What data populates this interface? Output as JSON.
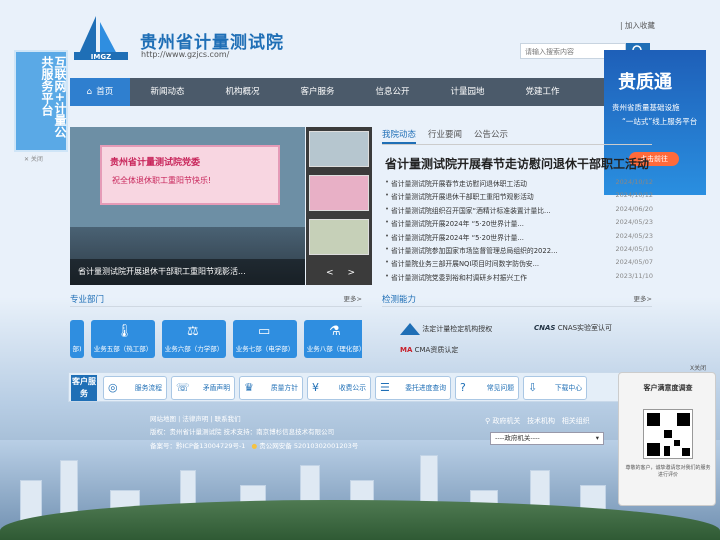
{
  "header": {
    "logo_abbr": "IMGZ",
    "title": "贵州省计量测试院",
    "url": "http://www.gzjcs.com/",
    "favorite": "| 加入收藏",
    "search_placeholder": "请输入搜索内容"
  },
  "nav": {
    "items": [
      {
        "label": "首页",
        "icon": "home-icon"
      },
      {
        "label": "新闻动态"
      },
      {
        "label": "机构概况"
      },
      {
        "label": "客户服务"
      },
      {
        "label": "信息公开"
      },
      {
        "label": "计量园地"
      },
      {
        "label": "党建工作"
      }
    ]
  },
  "float_left": {
    "text": "互联网+计量公共服务平台"
  },
  "ad_right": {
    "title": "贵质通",
    "subtitle1": "贵州省质量基础设施",
    "subtitle2": "“一站式”线上服务平台",
    "button": "点击前往"
  },
  "slide": {
    "banner_title": "贵州省计量测试院党委",
    "banner_sub": "祝全体退休职工重阳节快乐!",
    "caption": "省计量测试院开展退休干部职工重阳节观影活...",
    "prev": "<",
    "next": ">"
  },
  "news": {
    "tabs": [
      "我院动态",
      "行业要闻",
      "公告公示"
    ],
    "headline": "省计量测试院开展春节走访慰问退休干部职工活动",
    "items": [
      {
        "title": "省计量测试院开展春节走访慰问退休职工活动",
        "date": "2024/10/12"
      },
      {
        "title": "省计量测试院开展退休干部职工重阳节观影活动",
        "date": "2024/10/12"
      },
      {
        "title": "省计量测试院组织召开国家“酒精计标准装置计量比...",
        "date": "2024/06/20"
      },
      {
        "title": "省计量测试院开展2024年 “5·20世界计量...",
        "date": "2024/05/23"
      },
      {
        "title": "省计量测试院开展2024年 “5·20世界计量...",
        "date": "2024/05/23"
      },
      {
        "title": "省计量测试院参加国家市场监督管理总局组织的2022...",
        "date": "2024/05/10"
      },
      {
        "title": "省计量院业务三部开展NQI项目时间数字防伪安...",
        "date": "2024/05/07"
      },
      {
        "title": "省计量测试院党委到裕和村调研乡村振兴工作",
        "date": "2023/11/10"
      }
    ]
  },
  "departments": {
    "title": "专业部门",
    "more": "更多>",
    "items": [
      {
        "label": "部)",
        "icon": "flask-icon"
      },
      {
        "label": "业务五部（热工部）",
        "icon": "thermometer-icon"
      },
      {
        "label": "业务六部（力学部）",
        "icon": "scale-icon"
      },
      {
        "label": "业务七部（电学部）",
        "icon": "battery-icon"
      },
      {
        "label": "业务八部（理化部）",
        "icon": "flask-icon"
      }
    ]
  },
  "abilities": {
    "title": "检测能力",
    "more": "更多>",
    "items": [
      {
        "label": "法定计量检定机构授权",
        "icon": "triangle-logo-icon"
      },
      {
        "label": "CNAS实验室认可",
        "icon": "cnas-logo-icon"
      },
      {
        "label": "CMA资质认定",
        "icon": "cma-logo-icon"
      }
    ]
  },
  "service": {
    "label": "客户服务",
    "items": [
      {
        "label": "服务流程",
        "icon": "flow-icon"
      },
      {
        "label": "矛盾声明",
        "icon": "statement-icon"
      },
      {
        "label": "质量方针",
        "icon": "quality-icon"
      },
      {
        "label": "收费公示",
        "icon": "fee-icon"
      },
      {
        "label": "委托进度查询",
        "icon": "progress-icon"
      },
      {
        "label": "常见问题",
        "icon": "faq-icon"
      },
      {
        "label": "下载中心",
        "icon": "download-icon"
      }
    ]
  },
  "footer": {
    "links": "网站地图 | 法律声明 | 联系我们",
    "copyright": "版权：贵州省计量测试院   技术支持：南京博杉信息技术有限公司",
    "icp": "备案号：黔ICP备13004729号-1",
    "police": "贵公网安备 52010302001203号",
    "right_links": [
      "政府机关",
      "技术机构",
      "相关组织"
    ],
    "select": "----政府机关----"
  },
  "survey": {
    "close": "X关闭",
    "title": "客户满意度调查",
    "text": "尊敬的客户，诚挚邀请您对我们的服务进行评价"
  }
}
